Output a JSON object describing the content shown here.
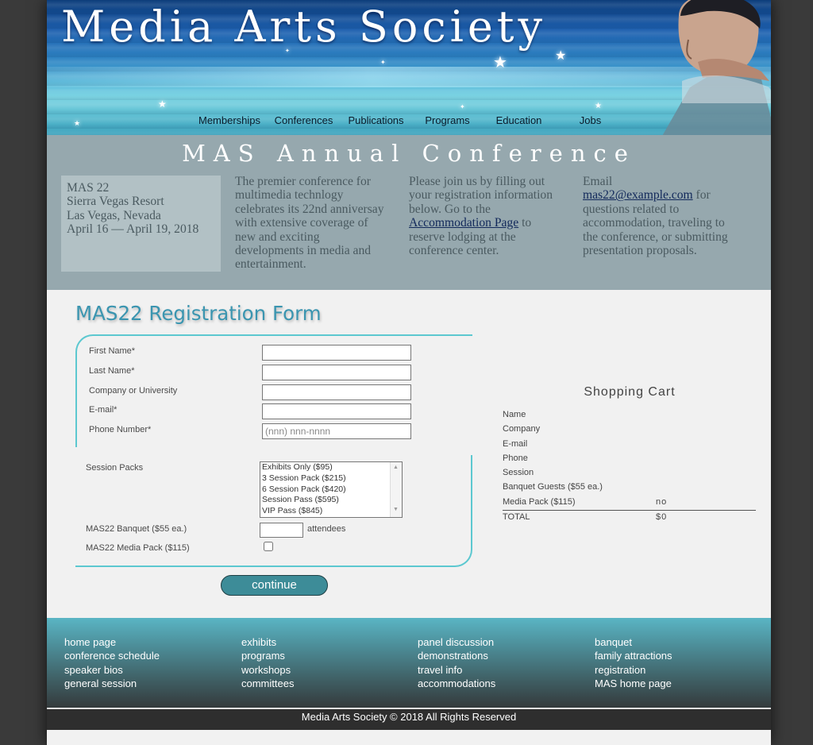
{
  "header": {
    "site_title": "Media Arts Society",
    "nav": [
      "Memberships",
      "Conferences",
      "Publications",
      "Programs",
      "Education",
      "Jobs"
    ]
  },
  "intro": {
    "conference_title": "MAS Annual Conference",
    "event": {
      "name": "MAS 22",
      "venue": "Sierra Vegas Resort",
      "city": "Las Vegas, Nevada",
      "dates": "April 16 — April 19, 2018"
    },
    "description": "The premier conference for multimedia technlogy celebrates its 22nd anniversay with extensive coverage of new and exciting developments in media and entertainment.",
    "join": {
      "text_before": "Please join us by filling out your registration information below. Go to the",
      "link": "Accommodation Page",
      "text_after": "to reserve lodging at the conference center."
    },
    "contact": {
      "text_before": "Email",
      "email": "mas22@example.com",
      "text_after": "for questions related to accommodation, traveling to the conference, or submitting presentation proposals."
    }
  },
  "form": {
    "title": "MAS22 Registration Form",
    "fields": {
      "first_name": {
        "label": "First Name*",
        "value": ""
      },
      "last_name": {
        "label": "Last Name*",
        "value": ""
      },
      "company": {
        "label": "Company or University",
        "value": ""
      },
      "email": {
        "label": "E-mail*",
        "value": ""
      },
      "phone": {
        "label": "Phone Number*",
        "placeholder": "(nnn) nnn-nnnn",
        "value": ""
      }
    },
    "session_packs": {
      "label": "Session Packs",
      "options": [
        "Exhibits Only ($95)",
        "3 Session Pack ($215)",
        "6 Session Pack ($420)",
        "Session Pass ($595)",
        "VIP Pass ($845)"
      ]
    },
    "banquet": {
      "label": "MAS22 Banquet ($55 ea.)",
      "suffix": "attendees",
      "value": ""
    },
    "media_pack": {
      "label": "MAS22 Media Pack ($115)",
      "checked": false
    },
    "continue_label": "continue"
  },
  "cart": {
    "title": "Shopping Cart",
    "rows": [
      "Name",
      "Company",
      "E-mail",
      "Phone",
      "Session",
      "Banquet Guests ($55 ea.)"
    ],
    "media_pack": {
      "label": "Media Pack ($115)",
      "value": "no"
    },
    "total": {
      "label": "TOTAL",
      "value": "$0"
    }
  },
  "footer": {
    "columns": [
      [
        "home page",
        "conference schedule",
        "speaker bios",
        "general session"
      ],
      [
        "exhibits",
        "programs",
        "workshops",
        "committees"
      ],
      [
        "panel discussion",
        "demonstrations",
        "travel info",
        "accommodations"
      ],
      [
        "banquet",
        "family attractions",
        "registration",
        "MAS home page"
      ]
    ],
    "copyright": "Media Arts Society © 2018 All Rights Reserved"
  }
}
